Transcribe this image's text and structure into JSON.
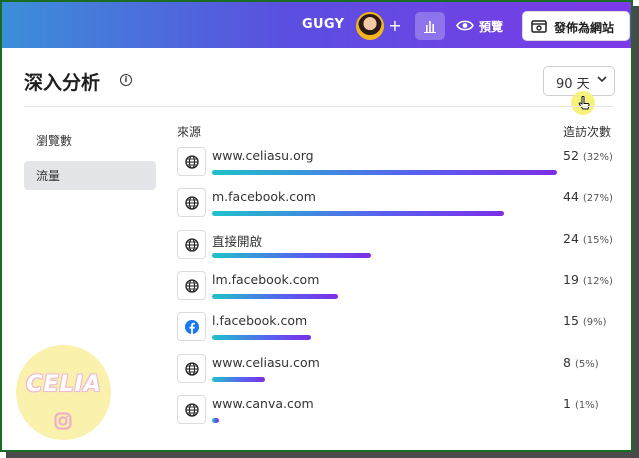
{
  "topbar": {
    "brand": "GUGY",
    "plus": "+",
    "preview_label": "預覽",
    "publish_label": "發佈為網站"
  },
  "header": {
    "title": "深入分析",
    "info": "i",
    "range": "90 天"
  },
  "sidebar": {
    "items": [
      {
        "label": "瀏覽數",
        "active": false
      },
      {
        "label": "流量",
        "active": true
      }
    ]
  },
  "table": {
    "col_source": "來源",
    "col_visits": "造訪次數",
    "rows": [
      {
        "icon": "globe-icon",
        "name": "www.celiasu.org",
        "visits": "52",
        "percent": "(32%)",
        "share": 1.0
      },
      {
        "icon": "globe-icon",
        "name": "m.facebook.com",
        "visits": "44",
        "percent": "(27%)",
        "share": 0.846
      },
      {
        "icon": "globe-icon",
        "name": "直接開啟",
        "visits": "24",
        "percent": "(15%)",
        "share": 0.462
      },
      {
        "icon": "globe-icon",
        "name": "lm.facebook.com",
        "visits": "19",
        "percent": "(12%)",
        "share": 0.365
      },
      {
        "icon": "facebook-icon",
        "name": "l.facebook.com",
        "visits": "15",
        "percent": "(9%)",
        "share": 0.288
      },
      {
        "icon": "globe-icon",
        "name": "www.celiasu.com",
        "visits": "8",
        "percent": "(5%)",
        "share": 0.154
      },
      {
        "icon": "globe-icon",
        "name": "www.canva.com",
        "visits": "1",
        "percent": "(1%)",
        "share": 0.019
      }
    ]
  },
  "watermark": {
    "text": "CELIA",
    "icon": "instagram-icon"
  },
  "colors": {
    "topbar_start": "#3b8fd8",
    "topbar_end": "#7d3ae8",
    "bar_start": "#1fc2c9",
    "bar_end": "#7c2ee6",
    "facebook": "#1877f2",
    "frame_border": "#1a6b23"
  }
}
